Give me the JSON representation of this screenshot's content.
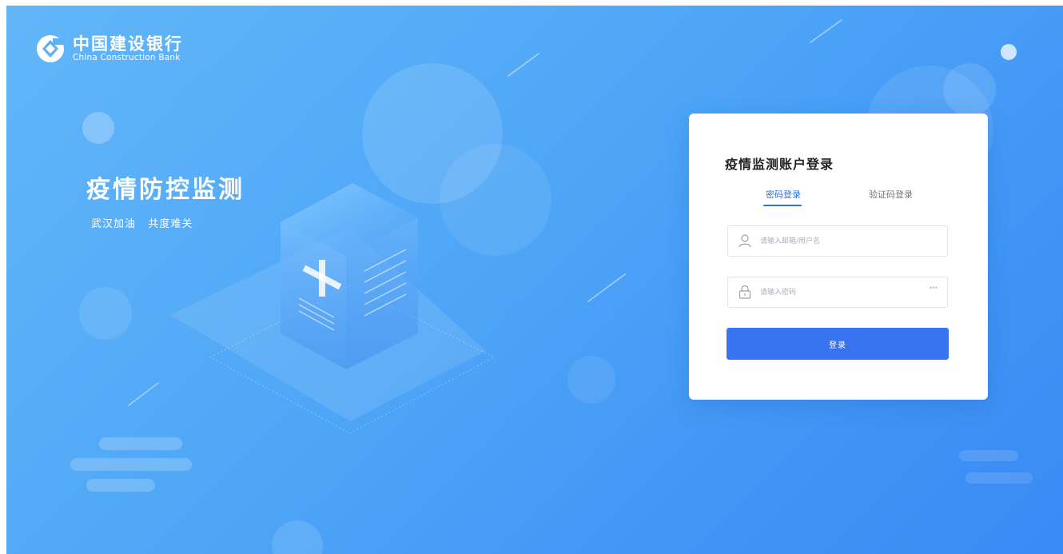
{
  "brand": {
    "name_cn": "中国建设银行",
    "name_en": "China Construction Bank",
    "logo_icon": "ccb-logo-icon"
  },
  "hero": {
    "title": "疫情防控监测",
    "subtitle": "武汉加油   共度难关"
  },
  "login": {
    "title": "疫情监测账户登录",
    "tabs": [
      {
        "label": "密码登录",
        "active": true
      },
      {
        "label": "验证码登录",
        "active": false
      }
    ],
    "username_placeholder": "请输入邮箱/用户名",
    "username_value": "",
    "password_placeholder": "请输入密码",
    "password_value": "",
    "password_toggle_label": "***",
    "submit_label": "登录",
    "icons": [
      "user-icon",
      "lock-icon"
    ]
  },
  "colors": {
    "background_start": "#62b6f8",
    "background_end": "#3a8af4",
    "accent": "#3873f0",
    "tab_active": "#2f6fe0"
  }
}
